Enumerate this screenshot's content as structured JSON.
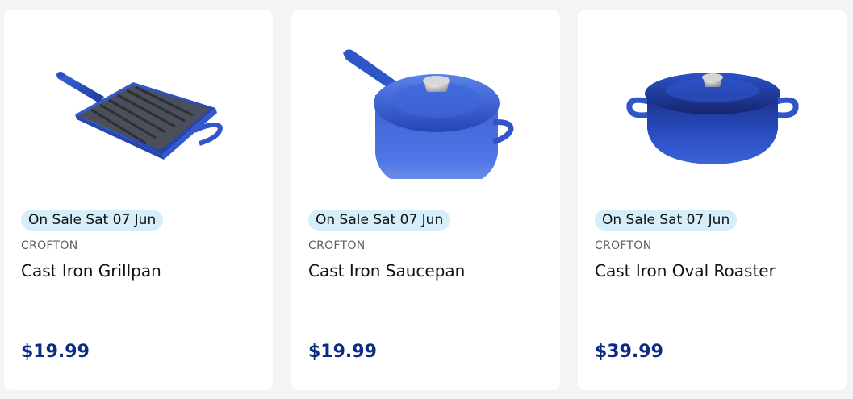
{
  "products": [
    {
      "badge": "On Sale Sat 07 Jun",
      "brand": "CROFTON",
      "name": "Cast Iron Grillpan",
      "price": "$19.99",
      "image": "grill-pan-image"
    },
    {
      "badge": "On Sale Sat 07 Jun",
      "brand": "CROFTON",
      "name": "Cast Iron Saucepan",
      "price": "$19.99",
      "image": "saucepan-image"
    },
    {
      "badge": "On Sale Sat 07 Jun",
      "brand": "CROFTON",
      "name": "Cast Iron Oval Roaster",
      "price": "$39.99",
      "image": "oval-roaster-image"
    }
  ],
  "colors": {
    "badge_bg": "#d6eefa",
    "price": "#0b2b85",
    "enamel_blue": "#2f56c8",
    "page_bg": "#f4f4f4"
  }
}
